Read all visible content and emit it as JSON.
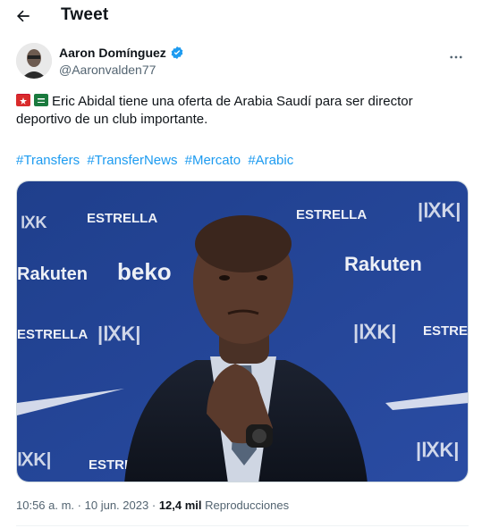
{
  "header": {
    "title": "Tweet",
    "back_icon": "arrow-left-icon"
  },
  "author": {
    "name": "Aaron Domínguez",
    "handle": "@Aaronvalden77",
    "verified": true,
    "verified_color": "#1d9bf0"
  },
  "tweet": {
    "flags": [
      "red-flag-emoji",
      "saudi-flag-emoji"
    ],
    "text": "Eric Abidal tiene una oferta de Arabia Saudí para ser director deportivo de un club importante.",
    "hashtags": [
      "#Transfers",
      "#TransferNews",
      "#Mercato",
      "#Arabic"
    ],
    "hashtag_color": "#1d9bf0"
  },
  "media": {
    "backdrop_words": [
      "ESTRELLA",
      "ESTRELLA",
      "Rakuten",
      "beko",
      "Rakuten",
      "ESTRELLA",
      "ESTRELLA",
      "ESTRELLA"
    ]
  },
  "meta": {
    "time": "10:56 a. m.",
    "separator": "·",
    "date": "10 jun. 2023",
    "views_count": "12,4 mil",
    "views_label": "Reproducciones"
  }
}
